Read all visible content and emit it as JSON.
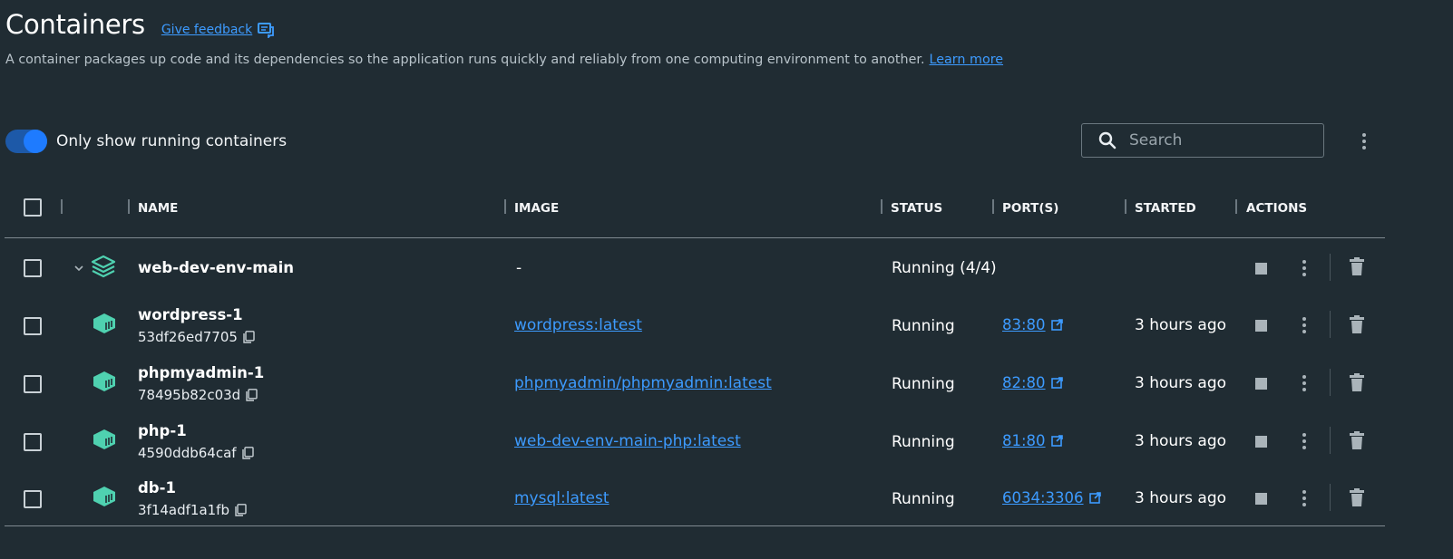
{
  "header": {
    "title": "Containers",
    "feedback_label": "Give feedback",
    "description": "A container packages up code and its dependencies so the application runs quickly and reliably from one computing environment to another.",
    "learn_more": "Learn more"
  },
  "filter": {
    "toggle_label": "Only show running containers",
    "toggle_on": true
  },
  "search": {
    "placeholder": "Search",
    "value": ""
  },
  "columns": {
    "name": "NAME",
    "image": "IMAGE",
    "status": "STATUS",
    "ports": "PORT(S)",
    "started": "STARTED",
    "actions": "ACTIONS"
  },
  "group": {
    "name": "web-dev-env-main",
    "image": "-",
    "status": "Running (4/4)"
  },
  "containers": [
    {
      "name": "wordpress-1",
      "id": "53df26ed7705",
      "image": "wordpress:latest",
      "status": "Running",
      "port": "83:80",
      "started": "3 hours ago"
    },
    {
      "name": "phpmyadmin-1",
      "id": "78495b82c03d",
      "image": "phpmyadmin/phpmyadmin:latest",
      "status": "Running",
      "port": "82:80",
      "started": "3 hours ago"
    },
    {
      "name": "php-1",
      "id": "4590ddb64caf",
      "image": "web-dev-env-main-php:latest",
      "status": "Running",
      "port": "81:80",
      "started": "3 hours ago"
    },
    {
      "name": "db-1",
      "id": "3f14adf1a1fb",
      "image": "mysql:latest",
      "status": "Running",
      "port": "6034:3306",
      "started": "3 hours ago"
    }
  ],
  "colors": {
    "background": "#202c33",
    "accent": "#1e7bff",
    "link": "#3d9bff",
    "container_icon": "#4fd1b0"
  },
  "icons": {
    "feedback": "feedback-icon",
    "search": "search-icon",
    "more": "kebab-icon",
    "expand": "chevron-down-icon",
    "stack": "stack-icon",
    "container": "container-icon",
    "copy": "copy-icon",
    "external": "external-link-icon",
    "stop": "stop-icon",
    "delete": "trash-icon"
  }
}
